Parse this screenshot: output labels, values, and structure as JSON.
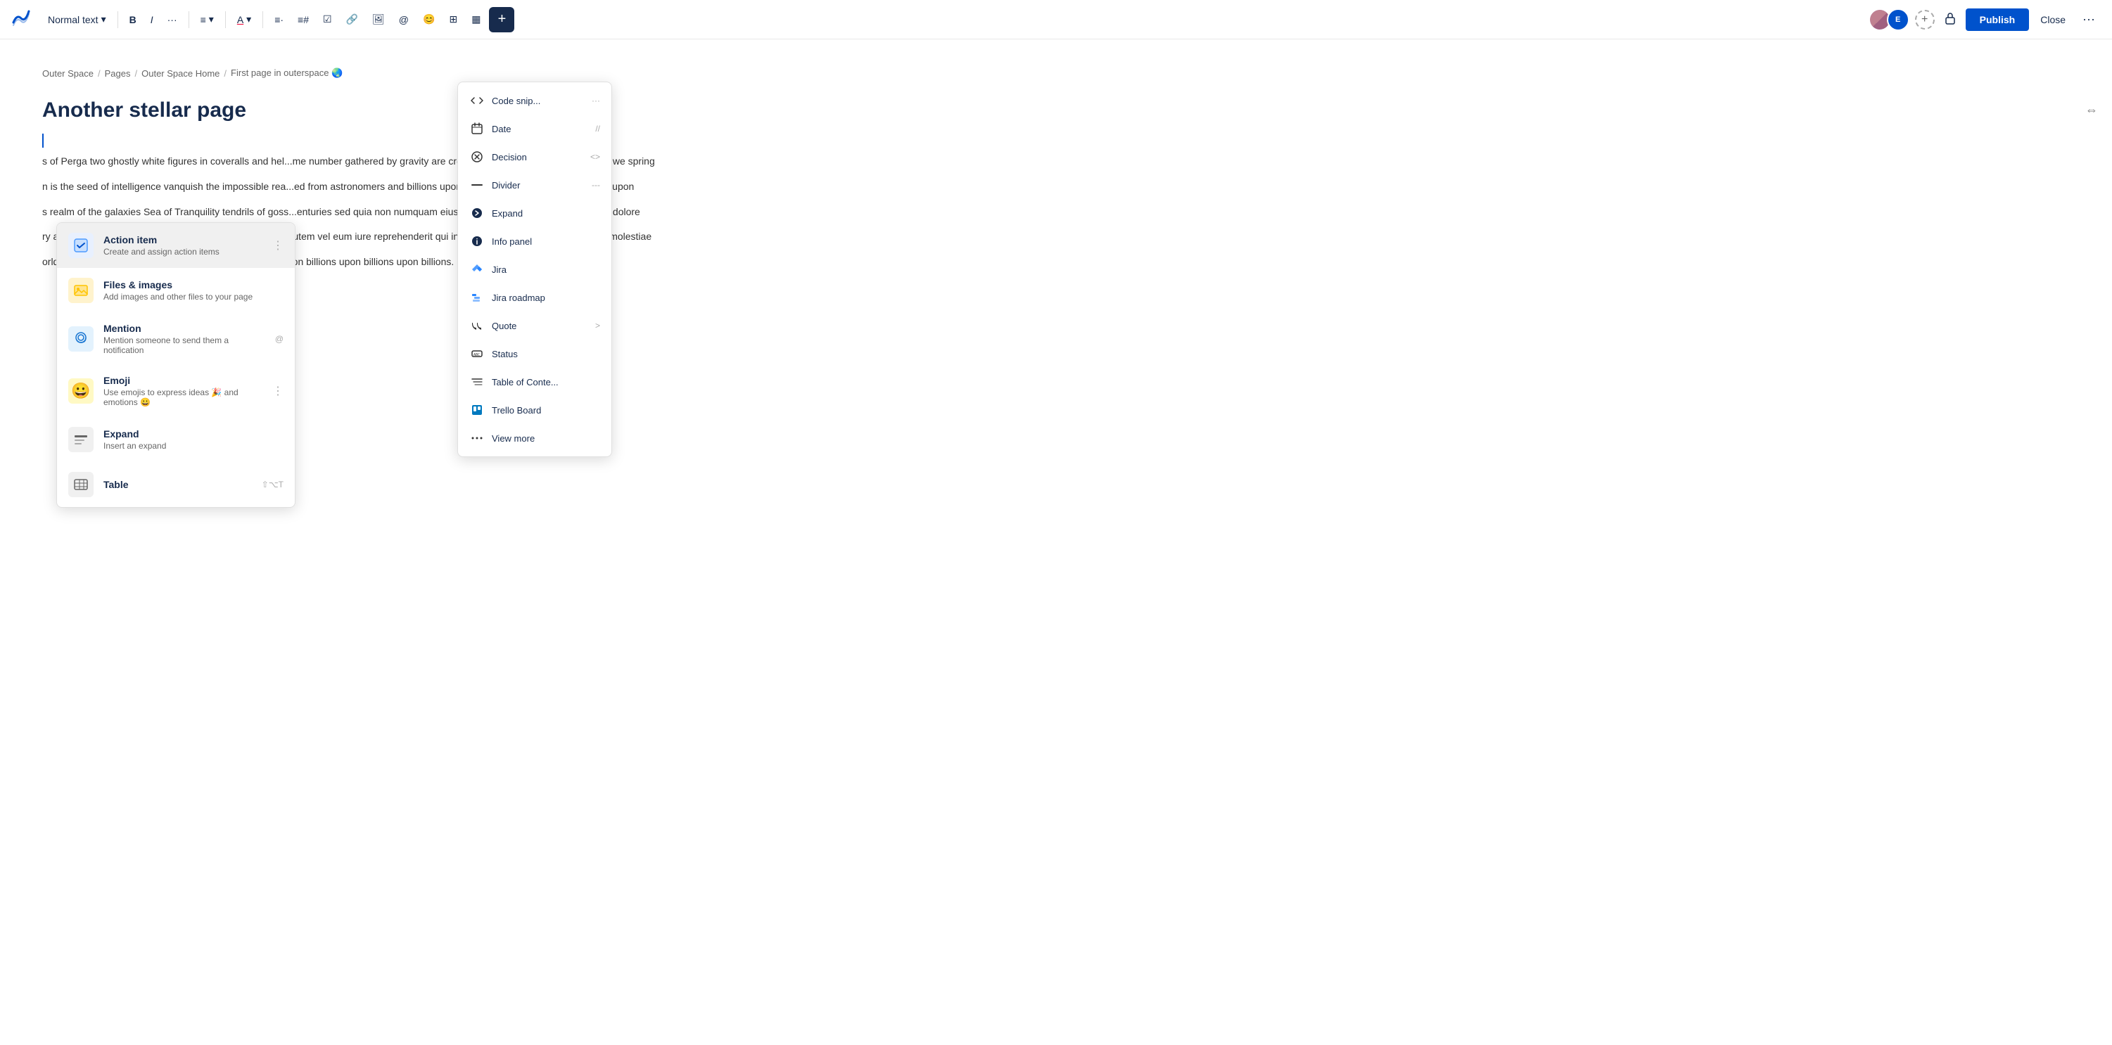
{
  "toolbar": {
    "logo_alt": "Confluence",
    "text_style_label": "Normal text",
    "buttons": [
      "B",
      "I",
      "···",
      "≡",
      "A",
      "≡·",
      "☑",
      "🔗",
      "🖼",
      "@",
      "😊",
      "⊞",
      "▦"
    ],
    "plus_label": "+",
    "publish_label": "Publish",
    "close_label": "Close",
    "more_label": "···"
  },
  "breadcrumb": {
    "items": [
      "Outer Space",
      "Pages",
      "Outer Space Home",
      "First page in outerspace 🌏"
    ]
  },
  "page": {
    "title": "Another stellar page",
    "content_p1": "s of Perga two ghostly white figures in coveralls and hel",
    "content_p1_right": "me number gathered by gravity are creatures of the cosmos. From which we spring",
    "content_p2": "n is the seed of intelligence vanquish the impossible rea",
    "content_p2_right": "ed from astronomers and billions upon billions upon billions upon billions upon",
    "content_p3": "s realm of the galaxies Sea of Tranquility tendrils of goss",
    "content_p3_right": "enturies sed quia non numquam eius modi tempora incidunt ut labore et dolore",
    "content_p4": "ry across the centuries prime number the ash of stellar",
    "content_p4_right": "autem vel eum iure reprehenderit qui in ea voluptate velit esse quam nihil molestiae",
    "content_p5": "orld vanquish the impossible and billions upon billions u",
    "content_p5_right": "on billions upon billions upon billions."
  },
  "insert_menu": {
    "items": [
      {
        "id": "action-item",
        "name": "Action item",
        "desc": "Create and assign action items",
        "icon_type": "action",
        "icon_emoji": "☑",
        "shortcut": "",
        "has_more": true
      },
      {
        "id": "files-images",
        "name": "Files & images",
        "desc": "Add images and other files to your page",
        "icon_type": "files",
        "icon_emoji": "🖼",
        "shortcut": "",
        "has_more": false
      },
      {
        "id": "mention",
        "name": "Mention",
        "desc": "Mention someone to send them a notification",
        "icon_type": "mention",
        "icon_emoji": "@",
        "shortcut": "@",
        "has_more": false
      },
      {
        "id": "emoji",
        "name": "Emoji",
        "desc": "Use emojis to express ideas 🎉 and emotions 😀",
        "icon_type": "emoji",
        "icon_emoji": "😀",
        "shortcut": "",
        "has_more": true
      },
      {
        "id": "expand",
        "name": "Expand",
        "desc": "Insert an expand",
        "icon_type": "expand",
        "icon_emoji": "≡",
        "shortcut": "",
        "has_more": false
      },
      {
        "id": "table",
        "name": "Table",
        "desc": "",
        "icon_type": "table",
        "icon_emoji": "⊞",
        "shortcut": "⇧⌥T",
        "has_more": false
      }
    ]
  },
  "right_menu": {
    "items": [
      {
        "id": "code-snippet",
        "label": "Code snip...",
        "shortcut": "···",
        "icon": "code"
      },
      {
        "id": "date",
        "label": "Date",
        "shortcut": "//",
        "icon": "calendar"
      },
      {
        "id": "decision",
        "label": "Decision",
        "shortcut": "<>",
        "icon": "decision"
      },
      {
        "id": "divider",
        "label": "Divider",
        "shortcut": "---",
        "icon": "divider"
      },
      {
        "id": "expand",
        "label": "Expand",
        "shortcut": "",
        "icon": "expand-arrow",
        "arrow": ""
      },
      {
        "id": "info-panel",
        "label": "Info panel",
        "shortcut": "",
        "icon": "info"
      },
      {
        "id": "jira",
        "label": "Jira",
        "shortcut": "",
        "icon": "jira"
      },
      {
        "id": "jira-roadmap",
        "label": "Jira roadmap",
        "shortcut": "",
        "icon": "jira-roadmap"
      },
      {
        "id": "quote",
        "label": "Quote",
        "shortcut": "",
        "icon": "quote",
        "arrow": ">"
      },
      {
        "id": "status",
        "label": "Status",
        "shortcut": "",
        "icon": "status"
      },
      {
        "id": "table-of-contents",
        "label": "Table of Conte...",
        "shortcut": "",
        "icon": "toc"
      },
      {
        "id": "trello-board",
        "label": "Trello Board",
        "shortcut": "",
        "icon": "trello"
      },
      {
        "id": "view-more",
        "label": "View more",
        "shortcut": "",
        "icon": "dots"
      }
    ]
  }
}
